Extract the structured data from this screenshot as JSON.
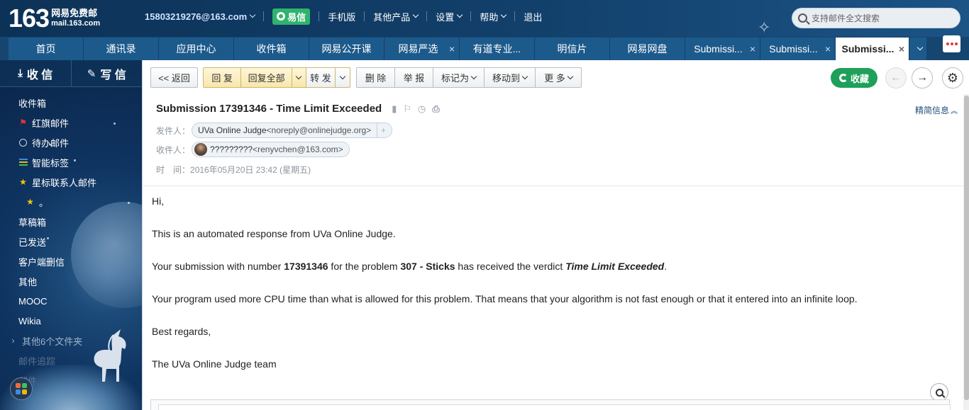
{
  "logo": {
    "number": "163",
    "line1": "网易免费邮",
    "line2": "mail.163.com"
  },
  "topnav": {
    "account": "15803219276@163.com",
    "yixin": "易信",
    "items": [
      "手机版",
      "其他产品",
      "设置",
      "帮助",
      "退出"
    ]
  },
  "search": {
    "placeholder": "支持邮件全文搜索"
  },
  "tabs": [
    {
      "label": "首页"
    },
    {
      "label": "通讯录"
    },
    {
      "label": "应用中心"
    },
    {
      "label": "收件箱"
    },
    {
      "label": "网易公开课"
    },
    {
      "label": "网易严选"
    },
    {
      "label": "有道专业..."
    },
    {
      "label": "明信片"
    },
    {
      "label": "网易网盘"
    },
    {
      "label": "Submissi..."
    },
    {
      "label": "Submissi..."
    },
    {
      "label": "Submissi..."
    }
  ],
  "sidebar": {
    "receive": "收 信",
    "write": "写 信",
    "folders": [
      {
        "label": "收件箱"
      },
      {
        "label": "红旗邮件"
      },
      {
        "label": "待办邮件"
      },
      {
        "label": "智能标签"
      },
      {
        "label": "星标联系人邮件"
      },
      {
        "label": "。"
      },
      {
        "label": "草稿箱"
      },
      {
        "label": "已发送"
      },
      {
        "label": "客户端删信"
      },
      {
        "label": "其他"
      },
      {
        "label": "MOOC"
      },
      {
        "label": "Wikia"
      },
      {
        "label": "其他6个文件夹"
      },
      {
        "label": "邮件追踪"
      },
      {
        "label": "邮件..."
      }
    ]
  },
  "toolbar": {
    "back": "<< 返回",
    "reply": "回 复",
    "reply_all": "回复全部",
    "forward": "转 发",
    "delete": "删 除",
    "report": "举 报",
    "mark_as": "标记为",
    "move_to": "移动到",
    "more": "更 多",
    "collect": "收藏"
  },
  "mail": {
    "subject": "Submission 17391346 - Time Limit Exceeded",
    "brief_info": "精简信息",
    "from_label": "发件人：",
    "from_name": "UVa Online Judge",
    "from_addr": "<noreply@onlinejudge.org>",
    "to_label": "收件人：",
    "to_name": "?????????",
    "to_addr": "<renyvchen@163.com>",
    "time_label": "时　间：",
    "time_value": "2016年05月20日 23:42 (星期五)",
    "body": {
      "greeting": "Hi,",
      "intro": "This is an automated response from UVa Online Judge.",
      "s1": "Your submission with number ",
      "number": "17391346",
      "s2": " for the problem ",
      "problem": "307 - Sticks",
      "s3": " has received the verdict ",
      "verdict": "Time Limit Exceeded",
      "s4": ".",
      "explain": "Your program used more CPU time than what is allowed for this problem. That means that your algorithm is not fast enough or that it entered into an infinite loop.",
      "regards": "Best regards,",
      "signature": "The UVa Online Judge team"
    }
  }
}
